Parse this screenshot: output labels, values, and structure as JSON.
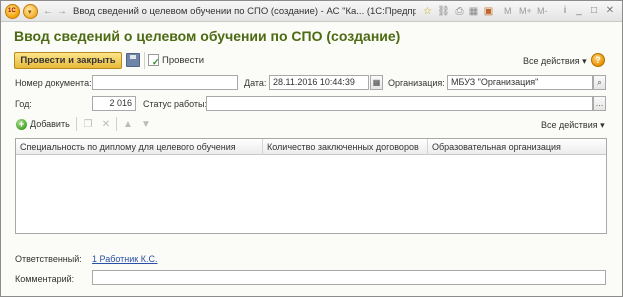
{
  "window": {
    "title": "Ввод сведений о целевом обучении по СПО (создание) - АС \"Ка...  (1С:Предприятие)",
    "m_buttons": [
      "M",
      "M+",
      "M-"
    ]
  },
  "form": {
    "title": "Ввод сведений о целевом обучении по СПО (создание)"
  },
  "toolbar": {
    "post_and_close": "Провести и закрыть",
    "post": "Провести",
    "all_actions": "Все действия",
    "help": "?"
  },
  "fields": {
    "doc_number_label": "Номер документа:",
    "doc_number_value": "",
    "date_label": "Дата:",
    "date_value": "28.11.2016 10:44:39",
    "org_label": "Организация:",
    "org_value": "МБУЗ \"Организация\"",
    "year_label": "Год:",
    "year_value": "2 016",
    "status_label": "Статус работы:",
    "status_value": ""
  },
  "list_toolbar": {
    "add": "Добавить",
    "all_actions": "Все действия"
  },
  "table": {
    "columns": [
      "Специальность по диплому для целевого обучения",
      "Количество заключенных договоров",
      "Образовательная организация"
    ],
    "rows": []
  },
  "footer": {
    "responsible_label": "Ответственный:",
    "responsible_value": "1 Работник К.С.",
    "comment_label": "Комментарий:",
    "comment_value": ""
  }
}
